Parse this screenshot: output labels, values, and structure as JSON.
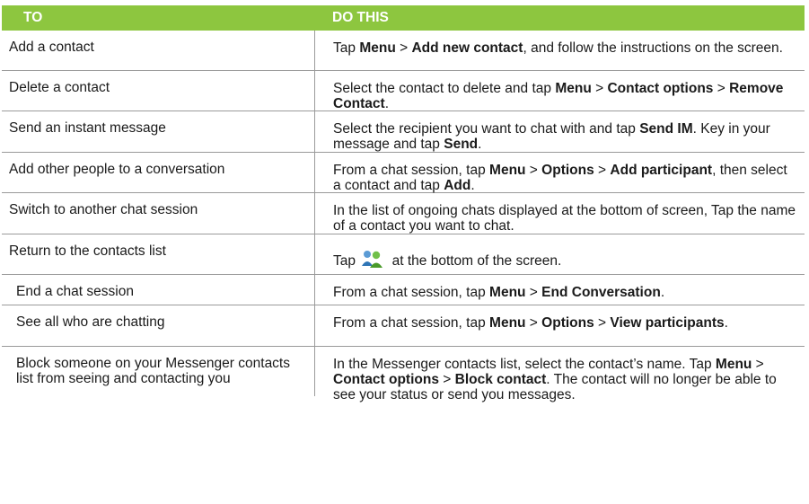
{
  "header": {
    "col1": "TO",
    "col2": "DO THIS"
  },
  "rows": [
    {
      "to": "Add a contact",
      "do": [
        {
          "t": "Tap "
        },
        {
          "b": "Menu"
        },
        {
          "t": " > "
        },
        {
          "b": "Add new contact"
        },
        {
          "t": ", and follow the instructions on the screen."
        }
      ]
    },
    {
      "to": "Delete a contact",
      "do": [
        {
          "t": "Select the contact to delete and tap "
        },
        {
          "b": "Menu"
        },
        {
          "t": " > "
        },
        {
          "b": "Contact options"
        },
        {
          "t": " > "
        },
        {
          "b": "Remove Contact"
        },
        {
          "t": "."
        }
      ]
    },
    {
      "to": "Send an instant message",
      "do": [
        {
          "t": "Select the recipient you want to chat with and tap "
        },
        {
          "b": "Send IM"
        },
        {
          "t": ". Key in your message and tap "
        },
        {
          "b": "Send"
        },
        {
          "t": "."
        }
      ]
    },
    {
      "to": "Add other people to a conversation",
      "do": [
        {
          "t": "From a chat session, tap "
        },
        {
          "b": "Menu"
        },
        {
          "t": " > "
        },
        {
          "b": "Options"
        },
        {
          "t": " > "
        },
        {
          "b": "Add participant"
        },
        {
          "t": ", then select a contact  and tap "
        },
        {
          "b": "Add"
        },
        {
          "t": "."
        }
      ]
    },
    {
      "to": "Switch to another chat session",
      "do": [
        {
          "t": "In the list of ongoing chats displayed at the bottom of screen, Tap the name of a contact you want to chat."
        }
      ]
    },
    {
      "to": "Return to the contacts list",
      "do": [
        {
          "t": "Tap "
        },
        {
          "icon": "contacts-icon"
        },
        {
          "t": " at the bottom of the screen."
        }
      ]
    },
    {
      "to": "End a chat session",
      "do": [
        {
          "t": "From a chat session, tap "
        },
        {
          "b": "Menu"
        },
        {
          "t": " > "
        },
        {
          "b": "End Conversation"
        },
        {
          "t": "."
        }
      ]
    },
    {
      "to": "See all who are chatting",
      "do": [
        {
          "t": "From a chat session, tap "
        },
        {
          "b": "Menu"
        },
        {
          "t": " > "
        },
        {
          "b": "Options"
        },
        {
          "t": " > "
        },
        {
          "b": "View participants"
        },
        {
          "t": "."
        }
      ]
    },
    {
      "to": "Block someone on your Messenger contacts list from seeing and contacting you",
      "do": [
        {
          "t": "In the Messenger contacts list, select the contact’s name. Tap "
        },
        {
          "b": "Menu"
        },
        {
          "t": " > "
        },
        {
          "b": "Contact options"
        },
        {
          "t": " > "
        },
        {
          "b": "Block contact"
        },
        {
          "t": ". The contact will no longer be able to see your status or send you messages."
        }
      ]
    }
  ],
  "colors": {
    "header_bg": "#8dc63f",
    "border": "#9a9a9a"
  }
}
